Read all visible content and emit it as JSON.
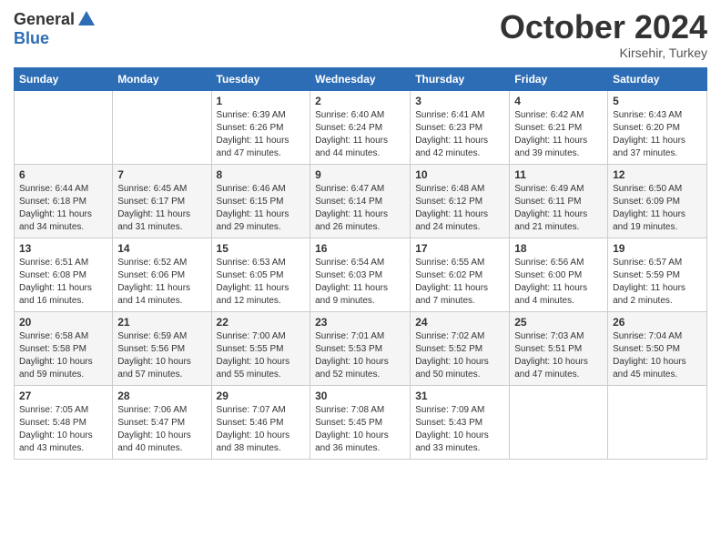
{
  "logo": {
    "general": "General",
    "blue": "Blue"
  },
  "title": "October 2024",
  "subtitle": "Kirsehir, Turkey",
  "headers": [
    "Sunday",
    "Monday",
    "Tuesday",
    "Wednesday",
    "Thursday",
    "Friday",
    "Saturday"
  ],
  "weeks": [
    [
      {
        "day": "",
        "sunrise": "",
        "sunset": "",
        "daylight": ""
      },
      {
        "day": "",
        "sunrise": "",
        "sunset": "",
        "daylight": ""
      },
      {
        "day": "1",
        "sunrise": "Sunrise: 6:39 AM",
        "sunset": "Sunset: 6:26 PM",
        "daylight": "Daylight: 11 hours and 47 minutes."
      },
      {
        "day": "2",
        "sunrise": "Sunrise: 6:40 AM",
        "sunset": "Sunset: 6:24 PM",
        "daylight": "Daylight: 11 hours and 44 minutes."
      },
      {
        "day": "3",
        "sunrise": "Sunrise: 6:41 AM",
        "sunset": "Sunset: 6:23 PM",
        "daylight": "Daylight: 11 hours and 42 minutes."
      },
      {
        "day": "4",
        "sunrise": "Sunrise: 6:42 AM",
        "sunset": "Sunset: 6:21 PM",
        "daylight": "Daylight: 11 hours and 39 minutes."
      },
      {
        "day": "5",
        "sunrise": "Sunrise: 6:43 AM",
        "sunset": "Sunset: 6:20 PM",
        "daylight": "Daylight: 11 hours and 37 minutes."
      }
    ],
    [
      {
        "day": "6",
        "sunrise": "Sunrise: 6:44 AM",
        "sunset": "Sunset: 6:18 PM",
        "daylight": "Daylight: 11 hours and 34 minutes."
      },
      {
        "day": "7",
        "sunrise": "Sunrise: 6:45 AM",
        "sunset": "Sunset: 6:17 PM",
        "daylight": "Daylight: 11 hours and 31 minutes."
      },
      {
        "day": "8",
        "sunrise": "Sunrise: 6:46 AM",
        "sunset": "Sunset: 6:15 PM",
        "daylight": "Daylight: 11 hours and 29 minutes."
      },
      {
        "day": "9",
        "sunrise": "Sunrise: 6:47 AM",
        "sunset": "Sunset: 6:14 PM",
        "daylight": "Daylight: 11 hours and 26 minutes."
      },
      {
        "day": "10",
        "sunrise": "Sunrise: 6:48 AM",
        "sunset": "Sunset: 6:12 PM",
        "daylight": "Daylight: 11 hours and 24 minutes."
      },
      {
        "day": "11",
        "sunrise": "Sunrise: 6:49 AM",
        "sunset": "Sunset: 6:11 PM",
        "daylight": "Daylight: 11 hours and 21 minutes."
      },
      {
        "day": "12",
        "sunrise": "Sunrise: 6:50 AM",
        "sunset": "Sunset: 6:09 PM",
        "daylight": "Daylight: 11 hours and 19 minutes."
      }
    ],
    [
      {
        "day": "13",
        "sunrise": "Sunrise: 6:51 AM",
        "sunset": "Sunset: 6:08 PM",
        "daylight": "Daylight: 11 hours and 16 minutes."
      },
      {
        "day": "14",
        "sunrise": "Sunrise: 6:52 AM",
        "sunset": "Sunset: 6:06 PM",
        "daylight": "Daylight: 11 hours and 14 minutes."
      },
      {
        "day": "15",
        "sunrise": "Sunrise: 6:53 AM",
        "sunset": "Sunset: 6:05 PM",
        "daylight": "Daylight: 11 hours and 12 minutes."
      },
      {
        "day": "16",
        "sunrise": "Sunrise: 6:54 AM",
        "sunset": "Sunset: 6:03 PM",
        "daylight": "Daylight: 11 hours and 9 minutes."
      },
      {
        "day": "17",
        "sunrise": "Sunrise: 6:55 AM",
        "sunset": "Sunset: 6:02 PM",
        "daylight": "Daylight: 11 hours and 7 minutes."
      },
      {
        "day": "18",
        "sunrise": "Sunrise: 6:56 AM",
        "sunset": "Sunset: 6:00 PM",
        "daylight": "Daylight: 11 hours and 4 minutes."
      },
      {
        "day": "19",
        "sunrise": "Sunrise: 6:57 AM",
        "sunset": "Sunset: 5:59 PM",
        "daylight": "Daylight: 11 hours and 2 minutes."
      }
    ],
    [
      {
        "day": "20",
        "sunrise": "Sunrise: 6:58 AM",
        "sunset": "Sunset: 5:58 PM",
        "daylight": "Daylight: 10 hours and 59 minutes."
      },
      {
        "day": "21",
        "sunrise": "Sunrise: 6:59 AM",
        "sunset": "Sunset: 5:56 PM",
        "daylight": "Daylight: 10 hours and 57 minutes."
      },
      {
        "day": "22",
        "sunrise": "Sunrise: 7:00 AM",
        "sunset": "Sunset: 5:55 PM",
        "daylight": "Daylight: 10 hours and 55 minutes."
      },
      {
        "day": "23",
        "sunrise": "Sunrise: 7:01 AM",
        "sunset": "Sunset: 5:53 PM",
        "daylight": "Daylight: 10 hours and 52 minutes."
      },
      {
        "day": "24",
        "sunrise": "Sunrise: 7:02 AM",
        "sunset": "Sunset: 5:52 PM",
        "daylight": "Daylight: 10 hours and 50 minutes."
      },
      {
        "day": "25",
        "sunrise": "Sunrise: 7:03 AM",
        "sunset": "Sunset: 5:51 PM",
        "daylight": "Daylight: 10 hours and 47 minutes."
      },
      {
        "day": "26",
        "sunrise": "Sunrise: 7:04 AM",
        "sunset": "Sunset: 5:50 PM",
        "daylight": "Daylight: 10 hours and 45 minutes."
      }
    ],
    [
      {
        "day": "27",
        "sunrise": "Sunrise: 7:05 AM",
        "sunset": "Sunset: 5:48 PM",
        "daylight": "Daylight: 10 hours and 43 minutes."
      },
      {
        "day": "28",
        "sunrise": "Sunrise: 7:06 AM",
        "sunset": "Sunset: 5:47 PM",
        "daylight": "Daylight: 10 hours and 40 minutes."
      },
      {
        "day": "29",
        "sunrise": "Sunrise: 7:07 AM",
        "sunset": "Sunset: 5:46 PM",
        "daylight": "Daylight: 10 hours and 38 minutes."
      },
      {
        "day": "30",
        "sunrise": "Sunrise: 7:08 AM",
        "sunset": "Sunset: 5:45 PM",
        "daylight": "Daylight: 10 hours and 36 minutes."
      },
      {
        "day": "31",
        "sunrise": "Sunrise: 7:09 AM",
        "sunset": "Sunset: 5:43 PM",
        "daylight": "Daylight: 10 hours and 33 minutes."
      },
      {
        "day": "",
        "sunrise": "",
        "sunset": "",
        "daylight": ""
      },
      {
        "day": "",
        "sunrise": "",
        "sunset": "",
        "daylight": ""
      }
    ]
  ]
}
